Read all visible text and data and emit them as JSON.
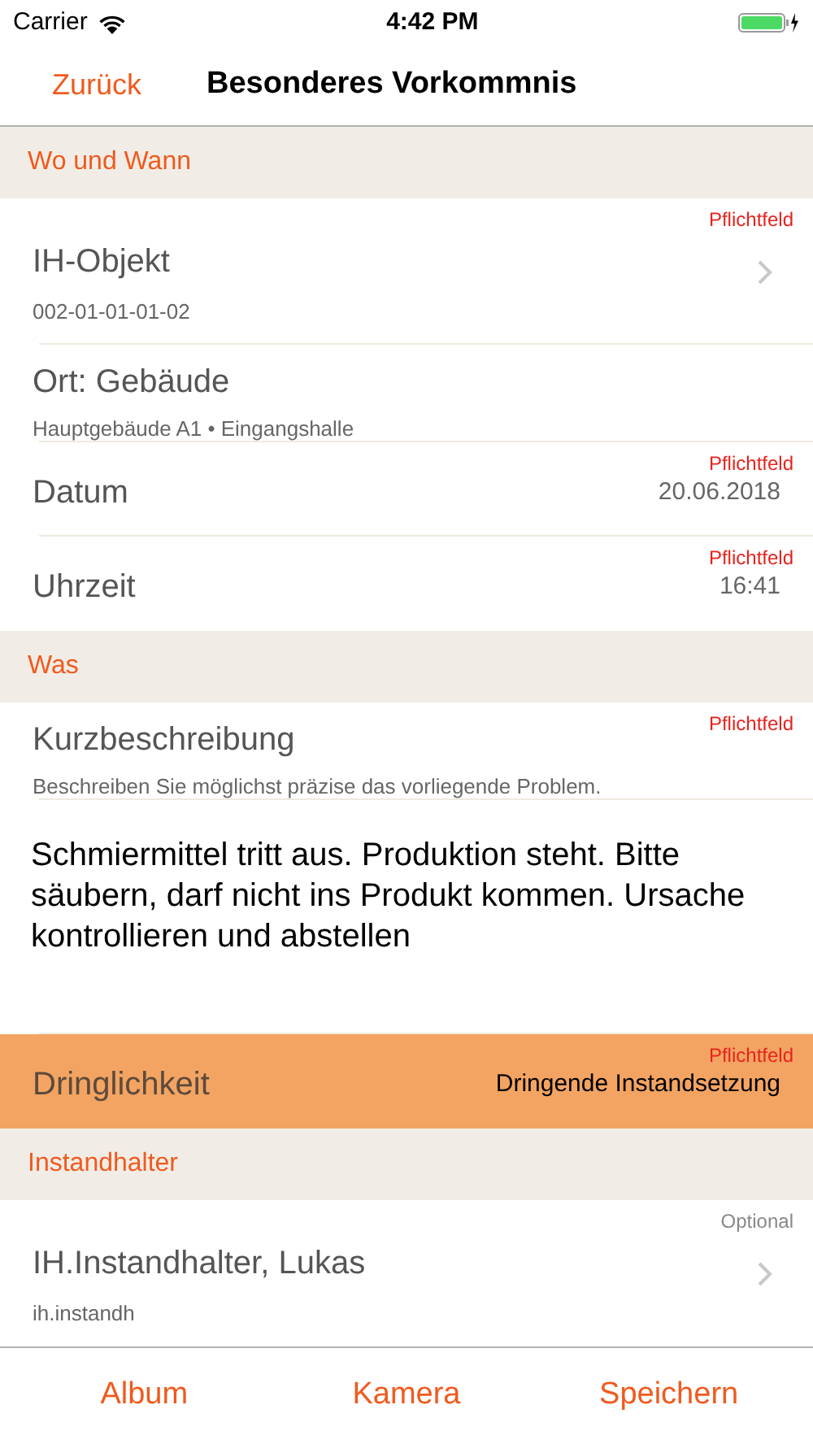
{
  "status_bar": {
    "carrier": "Carrier",
    "time": "4:42 PM"
  },
  "nav_bar": {
    "back": "Zurück",
    "title": "Besonderes Vorkommnis"
  },
  "sections": [
    {
      "title": "Wo und Wann",
      "items": [
        {
          "kind": "nav",
          "title": "IH-Objekt",
          "subtitle": "002-01-01-01-02",
          "badge": "Pflichtfeld",
          "required": true,
          "highlighted": false
        },
        {
          "kind": "info",
          "title": "Ort: Gebäude",
          "subtitle": "Hauptgebäude A1 • Eingangshalle",
          "highlighted": false
        },
        {
          "kind": "value",
          "title": "Datum",
          "value": "20.06.2018",
          "badge": "Pflichtfeld",
          "required": true,
          "highlighted": false
        },
        {
          "kind": "value",
          "title": "Uhrzeit",
          "value": "16:41",
          "badge": "Pflichtfeld",
          "required": true,
          "highlighted": false
        }
      ]
    },
    {
      "title": "Was",
      "items": [
        {
          "kind": "info",
          "title": "Kurzbeschreibung",
          "subtitle": "Beschreiben Sie möglichst präzise das vorliegende Problem.",
          "badge": "Pflichtfeld",
          "required": true,
          "highlighted": false
        },
        {
          "kind": "text",
          "text": "Schmiermittel tritt aus. Produktion steht. Bitte säubern, darf nicht ins Produkt kommen. Ursache kontrollieren und abstellen",
          "highlighted": false
        },
        {
          "kind": "value",
          "title": "Dringlichkeit",
          "value": "Dringende Instandsetzung",
          "badge": "Pflichtfeld",
          "required": true,
          "highlighted": true
        }
      ]
    },
    {
      "title": "Instandhalter",
      "items": [
        {
          "kind": "nav",
          "title": "IH.Instandhalter, Lukas",
          "subtitle": "ih.instandh",
          "badge": "Optional",
          "required": false,
          "highlighted": false
        }
      ]
    }
  ],
  "toolbar": [
    "Album",
    "Kamera",
    "Speichern"
  ]
}
